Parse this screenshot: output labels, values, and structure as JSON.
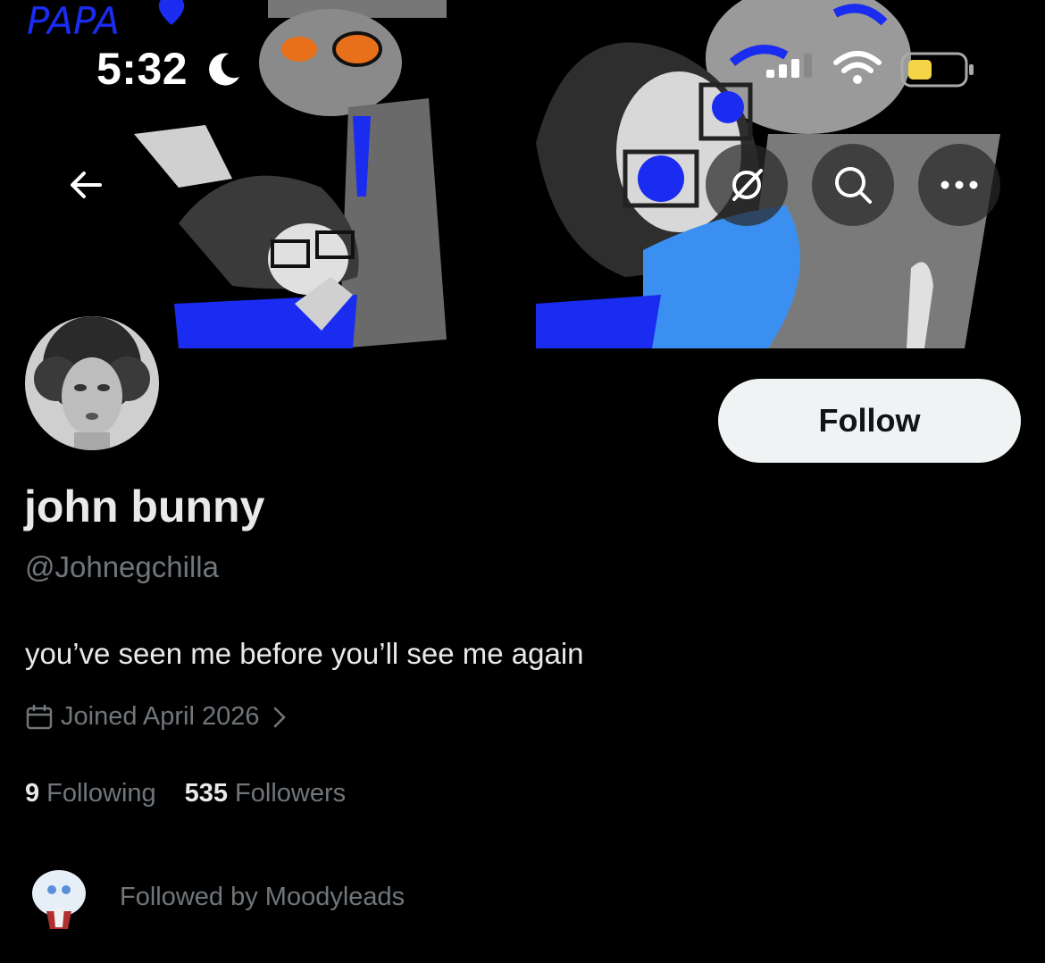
{
  "status_bar": {
    "time": "5:32",
    "icons": [
      "moon-icon",
      "signal-icon",
      "wifi-icon",
      "battery-icon"
    ],
    "battery_color": "#f5d547"
  },
  "banner": {
    "scrawled_text": "PAPA",
    "colors": {
      "blue": "#1a2cf0",
      "light_blue": "#3a8ff0",
      "gray": "#8a8a8a",
      "dark_gray": "#3a3a3a"
    }
  },
  "nav": {
    "back_icon": "back-arrow-icon",
    "grok_icon": "grok-icon",
    "search_icon": "search-icon",
    "more_icon": "more-icon"
  },
  "profile": {
    "display_name": "john bunny",
    "handle": "@Johnegchilla",
    "bio": "you’ve seen me before you’ll see me again",
    "joined": "Joined April 2026",
    "following_count": "9",
    "following_label": "Following",
    "followers_count": "535",
    "followers_label": "Followers",
    "followed_by": "Followed by Moodyleads"
  },
  "actions": {
    "follow_label": "Follow"
  },
  "theme": {
    "background": "#000000",
    "text_primary": "#e7e9ea",
    "text_secondary": "#71767b",
    "button_bg": "#eff3f4"
  }
}
